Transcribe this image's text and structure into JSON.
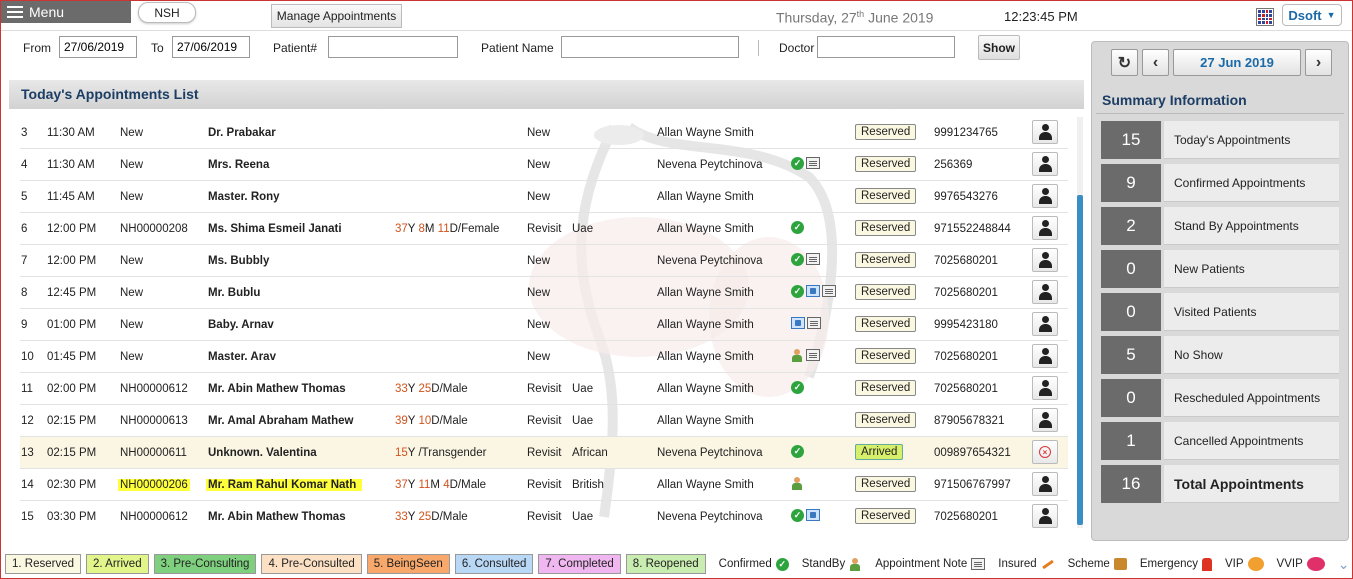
{
  "topbar": {
    "menu_label": "Menu",
    "facility": "NSH",
    "manage_label": "Manage Appointments",
    "date_weekday": "Thursday, 27",
    "date_suffix": "th",
    "date_rest": " June 2019",
    "time": "12:23:45 PM",
    "user": "Dsoft"
  },
  "filter": {
    "from_label": "From",
    "from_value": "27/06/2019",
    "to_label": "To",
    "to_value": "27/06/2019",
    "patient_no_label": "Patient#",
    "patient_no_value": "",
    "patient_name_label": "Patient Name",
    "patient_name_value": "",
    "doctor_label": "Doctor",
    "doctor_value": "",
    "show_label": "Show"
  },
  "list": {
    "title": "Today's Appointments List",
    "rows": [
      {
        "num": "3",
        "time": "11:30 AM",
        "pid": "New",
        "name": "Dr. Prabakar",
        "age": "",
        "type": "New",
        "nat": "",
        "doc": "Allan Wayne Smith",
        "icons": [],
        "status": "Reserved",
        "phone": "9991234765"
      },
      {
        "num": "4",
        "time": "11:30 AM",
        "pid": "New",
        "name": "Mrs. Reena",
        "age": "",
        "type": "New",
        "nat": "",
        "doc": "Nevena Peytchinova",
        "icons": [
          "confirmed",
          "note"
        ],
        "status": "Reserved",
        "phone": "256369"
      },
      {
        "num": "5",
        "time": "11:45 AM",
        "pid": "New",
        "name": "Master. Rony",
        "age": "",
        "type": "New",
        "nat": "",
        "doc": "Allan Wayne Smith",
        "icons": [],
        "status": "Reserved",
        "phone": "9976543276"
      },
      {
        "num": "6",
        "time": "12:00 PM",
        "pid": "NH00000208",
        "name": "Ms. Shima Esmeil Janati",
        "age": [
          "37",
          "Y ",
          "8",
          "M ",
          "11",
          "D/Female"
        ],
        "type": "Revisit",
        "nat": "Uae",
        "doc": "Allan Wayne Smith",
        "icons": [
          "confirmed"
        ],
        "status": "Reserved",
        "phone": "971552248844"
      },
      {
        "num": "7",
        "time": "12:00 PM",
        "pid": "New",
        "name": "Ms. Bubbly",
        "age": "",
        "type": "New",
        "nat": "",
        "doc": "Nevena Peytchinova",
        "icons": [
          "confirmed",
          "note"
        ],
        "status": "Reserved",
        "phone": "7025680201"
      },
      {
        "num": "8",
        "time": "12:45 PM",
        "pid": "New",
        "name": "Mr. Bublu",
        "age": "",
        "type": "New",
        "nat": "",
        "doc": "Allan Wayne Smith",
        "icons": [
          "confirmed",
          "insured",
          "note"
        ],
        "status": "Reserved",
        "phone": "7025680201"
      },
      {
        "num": "9",
        "time": "01:00 PM",
        "pid": "New",
        "name": "Baby. Arnav",
        "age": "",
        "type": "New",
        "nat": "",
        "doc": "Allan Wayne Smith",
        "icons": [
          "insured",
          "note"
        ],
        "status": "Reserved",
        "phone": "9995423180"
      },
      {
        "num": "10",
        "time": "01:45 PM",
        "pid": "New",
        "name": "Master. Arav",
        "age": "",
        "type": "New",
        "nat": "",
        "doc": "Allan Wayne Smith",
        "icons": [
          "standby",
          "note"
        ],
        "status": "Reserved",
        "phone": "7025680201"
      },
      {
        "num": "11",
        "time": "02:00 PM",
        "pid": "NH00000612",
        "name": "Mr. Abin Mathew Thomas",
        "age": [
          "33",
          "Y ",
          "25",
          "D/Male"
        ],
        "type": "Revisit",
        "nat": "Uae",
        "doc": "Allan Wayne Smith",
        "icons": [
          "confirmed"
        ],
        "status": "Reserved",
        "phone": "7025680201"
      },
      {
        "num": "12",
        "time": "02:15 PM",
        "pid": "NH00000613",
        "name": "Mr. Amal Abraham Mathew",
        "age": [
          "39",
          "Y ",
          "10",
          "D/Male"
        ],
        "type": "Revisit",
        "nat": "Uae",
        "doc": "Allan Wayne Smith",
        "icons": [],
        "status": "Reserved",
        "phone": "87905678321"
      },
      {
        "num": "13",
        "time": "02:15 PM",
        "pid": "NH00000611",
        "name": "Unknown. Valentina",
        "age": [
          "15",
          "Y /Transgender"
        ],
        "type": "Revisit",
        "nat": "African",
        "doc": "Nevena Peytchinova",
        "icons": [
          "confirmed"
        ],
        "status": "Arrived",
        "phone": "009897654321",
        "highlight": true,
        "cancel": true
      },
      {
        "num": "14",
        "time": "02:30 PM",
        "pid": "NH00000206",
        "name": "Mr. Ram Rahul Komar Nath",
        "age": [
          "37",
          "Y ",
          "11",
          "M ",
          "4",
          "D/Male"
        ],
        "type": "Revisit",
        "nat": "British",
        "doc": "Allan Wayne Smith",
        "icons": [
          "standby"
        ],
        "status": "Reserved",
        "phone": "971506767997",
        "marked": true
      },
      {
        "num": "15",
        "time": "03:30 PM",
        "pid": "NH00000612",
        "name": "Mr. Abin Mathew Thomas",
        "age": [
          "33",
          "Y ",
          "25",
          "D/Male"
        ],
        "type": "Revisit",
        "nat": "Uae",
        "doc": "Nevena Peytchinova",
        "icons": [
          "confirmed",
          "insured"
        ],
        "status": "Reserved",
        "phone": "7025680201"
      }
    ]
  },
  "summary": {
    "date": "27 Jun 2019",
    "title": "Summary Information",
    "items": [
      {
        "count": "15",
        "label": "Today's Appointments"
      },
      {
        "count": "9",
        "label": "Confirmed Appointments"
      },
      {
        "count": "2",
        "label": "Stand By Appointments"
      },
      {
        "count": "0",
        "label": "New Patients"
      },
      {
        "count": "0",
        "label": "Visited Patients"
      },
      {
        "count": "5",
        "label": "No Show"
      },
      {
        "count": "0",
        "label": "Rescheduled Appointments"
      },
      {
        "count": "1",
        "label": "Cancelled Appointments"
      },
      {
        "count": "16",
        "label": "Total Appointments"
      }
    ]
  },
  "legend": {
    "statuses": [
      {
        "label": "1. Reserved",
        "color": "#fbf8e2"
      },
      {
        "label": "2. Arrived",
        "color": "#e1f58a"
      },
      {
        "label": "3. Pre-Consulting",
        "color": "#7ed07e"
      },
      {
        "label": "4. Pre-Consulted",
        "color": "#fbe0c4"
      },
      {
        "label": "5. BeingSeen",
        "color": "#f7a86a"
      },
      {
        "label": "6. Consulted",
        "color": "#b9d8f5"
      },
      {
        "label": "7. Completed",
        "color": "#efb6ef"
      },
      {
        "label": "8. Reopened",
        "color": "#c9edb0"
      }
    ],
    "confirmed": "Confirmed",
    "standby": "StandBy",
    "note": "Appointment Note",
    "insured": "Insured",
    "scheme": "Scheme",
    "emergency": "Emergency",
    "vip": "VIP",
    "vvip": "VVIP"
  }
}
